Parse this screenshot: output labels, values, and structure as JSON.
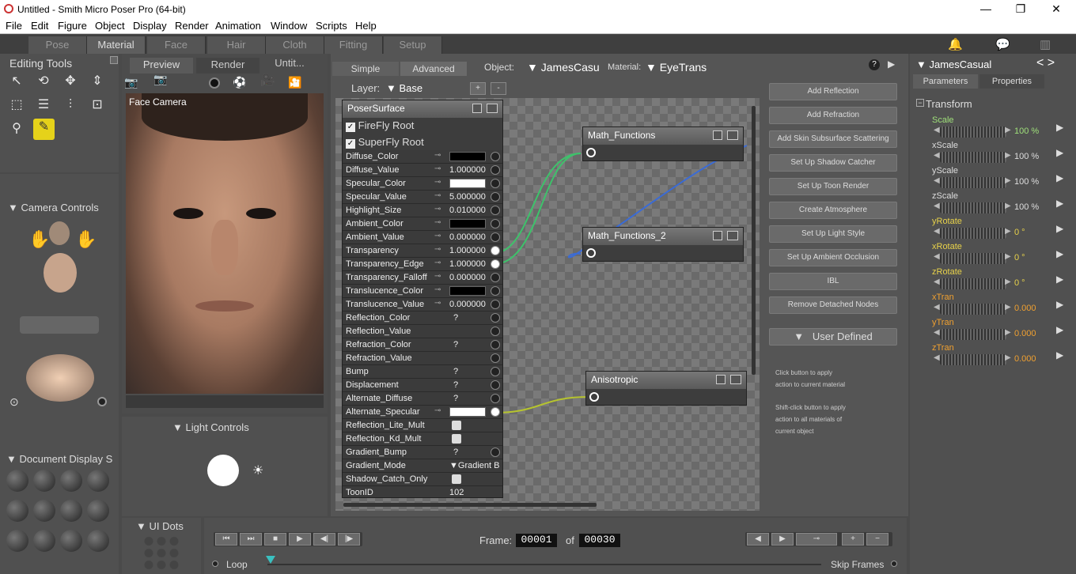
{
  "window": {
    "title": "Untitled - Smith Micro Poser Pro  (64-bit)"
  },
  "menu": [
    "File",
    "Edit",
    "Figure",
    "Object",
    "Display",
    "Render",
    "Animation",
    "Window",
    "Scripts",
    "Help"
  ],
  "rooms": [
    "Pose",
    "Material",
    "Face",
    "Hair",
    "Cloth",
    "Fitting",
    "Setup"
  ],
  "editing_tools": {
    "title": "Editing Tools"
  },
  "camera_controls": {
    "title": "Camera Controls"
  },
  "light_controls": {
    "title": "Light Controls"
  },
  "document_display": {
    "title": "Document Display S"
  },
  "ui_dots": {
    "title": "UI Dots"
  },
  "viewport": {
    "tabs": [
      "Preview",
      "Render",
      "Untit..."
    ],
    "camera_label": "Face Camera"
  },
  "material": {
    "tabs": [
      "Simple",
      "Advanced"
    ],
    "object_label": "Object:",
    "object_value": "JamesCasu",
    "material_label": "Material:",
    "material_value": "EyeTrans",
    "layer_label": "Layer:",
    "layer_value": "Base",
    "root_node": "PoserSurface",
    "roots": [
      "FireFly Root",
      "SuperFly Root"
    ],
    "rows": [
      {
        "name": "Diffuse_Color",
        "kind": "color",
        "color": "#000000"
      },
      {
        "name": "Diffuse_Value",
        "kind": "num",
        "value": "1.000000"
      },
      {
        "name": "Specular_Color",
        "kind": "color",
        "color": "#ffffff"
      },
      {
        "name": "Specular_Value",
        "kind": "num",
        "value": "5.000000"
      },
      {
        "name": "Highlight_Size",
        "kind": "num",
        "value": "0.010000"
      },
      {
        "name": "Ambient_Color",
        "kind": "color",
        "color": "#000000"
      },
      {
        "name": "Ambient_Value",
        "kind": "num",
        "value": "0.000000"
      },
      {
        "name": "Transparency",
        "kind": "num",
        "value": "1.000000"
      },
      {
        "name": "Transparency_Edge",
        "kind": "num",
        "value": "1.000000"
      },
      {
        "name": "Transparency_Falloff",
        "kind": "num",
        "value": "0.000000"
      },
      {
        "name": "Translucence_Color",
        "kind": "color",
        "color": "#000000"
      },
      {
        "name": "Translucence_Value",
        "kind": "num",
        "value": "0.000000"
      },
      {
        "name": "Reflection_Color",
        "kind": "q",
        "value": "?"
      },
      {
        "name": "Reflection_Value",
        "kind": "blank"
      },
      {
        "name": "Refraction_Color",
        "kind": "q",
        "value": "?"
      },
      {
        "name": "Refraction_Value",
        "kind": "blank"
      },
      {
        "name": "Bump",
        "kind": "q",
        "value": "?"
      },
      {
        "name": "Displacement",
        "kind": "q",
        "value": "?"
      },
      {
        "name": "Alternate_Diffuse",
        "kind": "q",
        "value": "?"
      },
      {
        "name": "Alternate_Specular",
        "kind": "color",
        "color": "#ffffff"
      },
      {
        "name": "Reflection_Lite_Mult",
        "kind": "check"
      },
      {
        "name": "Reflection_Kd_Mult",
        "kind": "check"
      },
      {
        "name": "Gradient_Bump",
        "kind": "q",
        "value": "?"
      },
      {
        "name": "Gradient_Mode",
        "kind": "text",
        "value": "▼Gradient B"
      },
      {
        "name": "Shadow_Catch_Only",
        "kind": "check"
      },
      {
        "name": "ToonID",
        "kind": "text",
        "value": "102"
      }
    ],
    "nodes": [
      "Math_Functions",
      "Math_Functions_2",
      "Anisotropic"
    ],
    "wizard_buttons": [
      "Add Reflection",
      "Add Refraction",
      "Add Skin Subsurface Scattering",
      "Set Up Shadow Catcher",
      "Set Up Toon Render",
      "Create Atmosphere",
      "Set Up Light Style",
      "Set Up Ambient Occlusion",
      "IBL",
      "Remove Detached Nodes"
    ],
    "user_defined": "User Defined",
    "help_text": [
      "Click button to apply",
      "action to current material",
      "Shift-click button to apply",
      "action to all materials of",
      "current object"
    ]
  },
  "parameters": {
    "figure": "JamesCasual",
    "tabs": [
      "Parameters",
      "Properties"
    ],
    "group": "Transform",
    "items": [
      {
        "name": "Scale",
        "value": "100 %",
        "color": "#9fe07a"
      },
      {
        "name": "xScale",
        "value": "100 %",
        "color": "#dddddd"
      },
      {
        "name": "yScale",
        "value": "100 %",
        "color": "#dddddd"
      },
      {
        "name": "zScale",
        "value": "100 %",
        "color": "#dddddd"
      },
      {
        "name": "yRotate",
        "value": "0 °",
        "color": "#e8d24a"
      },
      {
        "name": "xRotate",
        "value": "0 °",
        "color": "#e8d24a"
      },
      {
        "name": "zRotate",
        "value": "0 °",
        "color": "#e8d24a"
      },
      {
        "name": "xTran",
        "value": "0.000",
        "color": "#f0a030"
      },
      {
        "name": "yTran",
        "value": "0.000",
        "color": "#f0a030"
      },
      {
        "name": "zTran",
        "value": "0.000",
        "color": "#f0a030"
      }
    ]
  },
  "timeline": {
    "frame_label": "Frame:",
    "frame": "00001",
    "of_label": "of",
    "total": "00030",
    "loop": "Loop",
    "skip": "Skip Frames"
  }
}
